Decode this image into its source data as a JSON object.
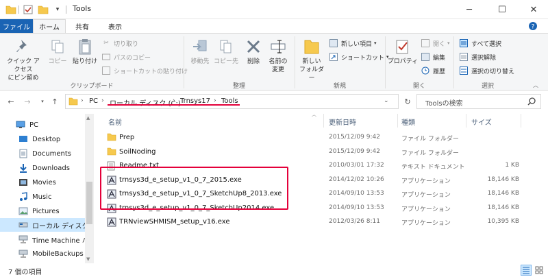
{
  "window": {
    "title": "Tools",
    "minimize": "─",
    "maximize": "☐",
    "close": "✕"
  },
  "ribbon_tabs": {
    "file": "ファイル",
    "home": "ホーム",
    "share": "共有",
    "view": "表示"
  },
  "ribbon": {
    "clipboard": {
      "group": "クリップボード",
      "pin": "クイック アクセス\nにピン留め",
      "copy": "コピー",
      "paste": "貼り付け",
      "cut": "切り取り",
      "copy_path": "パスのコピー",
      "paste_shortcut": "ショートカットの貼り付け"
    },
    "organize": {
      "group": "整理",
      "move_to": "移動先",
      "copy_to": "コピー先",
      "delete": "削除",
      "rename": "名前の\n変更"
    },
    "new": {
      "group": "新規",
      "new_folder": "新しい\nフォルダー",
      "new_item": "新しい項目",
      "shortcut": "ショートカット"
    },
    "open": {
      "group": "開く",
      "properties": "プロパティ",
      "open": "開く",
      "edit": "編集",
      "history": "履歴"
    },
    "select": {
      "group": "選択",
      "select_all": "すべて選択",
      "select_none": "選択解除",
      "invert": "選択の切り替え"
    }
  },
  "address": {
    "crumbs": [
      "PC",
      "ローカル ディスク (C:)",
      "Trnsys17",
      "Tools"
    ],
    "search_placeholder": "Toolsの検索"
  },
  "sidebar": {
    "items": [
      {
        "label": "PC"
      },
      {
        "label": "Desktop"
      },
      {
        "label": "Documents"
      },
      {
        "label": "Downloads"
      },
      {
        "label": "Movies"
      },
      {
        "label": "Music"
      },
      {
        "label": "Pictures"
      },
      {
        "label": "ローカル ディスク (C"
      },
      {
        "label": "Time Machine バ"
      },
      {
        "label": "MobileBackups ("
      }
    ]
  },
  "columns": {
    "name": "名前",
    "date": "更新日時",
    "type": "種類",
    "size": "サイズ"
  },
  "files": [
    {
      "name": "Prep",
      "date": "2015/12/09 9:42",
      "type": "ファイル フォルダー",
      "size": "",
      "kind": "folder"
    },
    {
      "name": "SoilNoding",
      "date": "2015/12/09 9:42",
      "type": "ファイル フォルダー",
      "size": "",
      "kind": "folder"
    },
    {
      "name": "Readme.txt",
      "date": "2010/03/01 17:32",
      "type": "テキスト ドキュメント",
      "size": "1 KB",
      "kind": "text"
    },
    {
      "name": "trnsys3d_e_setup_v1_0_7_2015.exe",
      "date": "2014/12/02 10:26",
      "type": "アプリケーション",
      "size": "18,146 KB",
      "kind": "exe"
    },
    {
      "name": "trnsys3d_e_setup_v1_0_7_SketchUp8_2013.exe",
      "date": "2014/09/10 13:53",
      "type": "アプリケーション",
      "size": "18,146 KB",
      "kind": "exe"
    },
    {
      "name": "trnsys3d_e_setup_v1_0_7_SketchUp2014.exe",
      "date": "2014/09/10 13:53",
      "type": "アプリケーション",
      "size": "18,146 KB",
      "kind": "exe"
    },
    {
      "name": "TRNviewSHMISM_setup_v16.exe",
      "date": "2012/03/26 8:11",
      "type": "アプリケーション",
      "size": "10,395 KB",
      "kind": "exe"
    }
  ],
  "status": {
    "item_count": "7 個の項目"
  },
  "colors": {
    "accent": "#1a64b4",
    "highlight": "#e4003a",
    "selection": "#cce8ff",
    "folder": "#f6c94e"
  }
}
